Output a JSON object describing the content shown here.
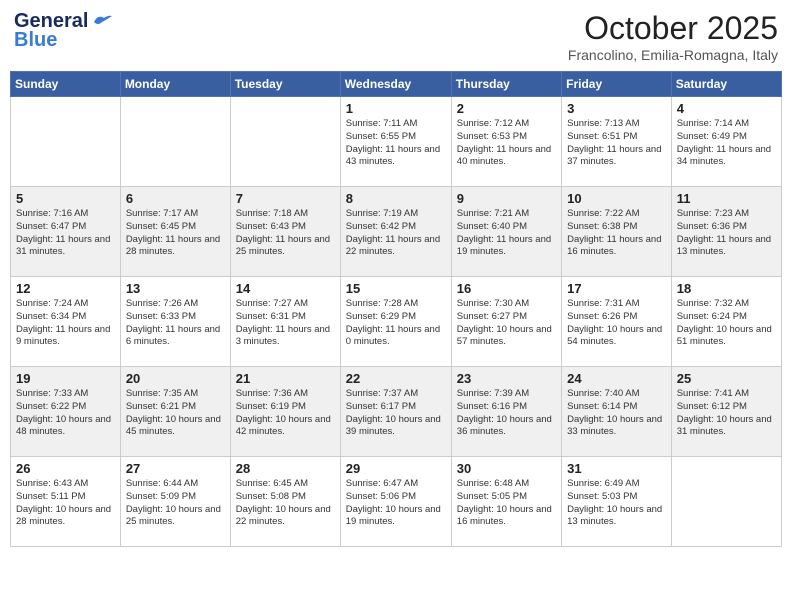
{
  "header": {
    "logo_line1": "General",
    "logo_line2": "Blue",
    "month": "October 2025",
    "location": "Francolino, Emilia-Romagna, Italy"
  },
  "days_of_week": [
    "Sunday",
    "Monday",
    "Tuesday",
    "Wednesday",
    "Thursday",
    "Friday",
    "Saturday"
  ],
  "weeks": [
    [
      {
        "day": "",
        "content": ""
      },
      {
        "day": "",
        "content": ""
      },
      {
        "day": "",
        "content": ""
      },
      {
        "day": "1",
        "content": "Sunrise: 7:11 AM\nSunset: 6:55 PM\nDaylight: 11 hours and 43 minutes."
      },
      {
        "day": "2",
        "content": "Sunrise: 7:12 AM\nSunset: 6:53 PM\nDaylight: 11 hours and 40 minutes."
      },
      {
        "day": "3",
        "content": "Sunrise: 7:13 AM\nSunset: 6:51 PM\nDaylight: 11 hours and 37 minutes."
      },
      {
        "day": "4",
        "content": "Sunrise: 7:14 AM\nSunset: 6:49 PM\nDaylight: 11 hours and 34 minutes."
      }
    ],
    [
      {
        "day": "5",
        "content": "Sunrise: 7:16 AM\nSunset: 6:47 PM\nDaylight: 11 hours and 31 minutes."
      },
      {
        "day": "6",
        "content": "Sunrise: 7:17 AM\nSunset: 6:45 PM\nDaylight: 11 hours and 28 minutes."
      },
      {
        "day": "7",
        "content": "Sunrise: 7:18 AM\nSunset: 6:43 PM\nDaylight: 11 hours and 25 minutes."
      },
      {
        "day": "8",
        "content": "Sunrise: 7:19 AM\nSunset: 6:42 PM\nDaylight: 11 hours and 22 minutes."
      },
      {
        "day": "9",
        "content": "Sunrise: 7:21 AM\nSunset: 6:40 PM\nDaylight: 11 hours and 19 minutes."
      },
      {
        "day": "10",
        "content": "Sunrise: 7:22 AM\nSunset: 6:38 PM\nDaylight: 11 hours and 16 minutes."
      },
      {
        "day": "11",
        "content": "Sunrise: 7:23 AM\nSunset: 6:36 PM\nDaylight: 11 hours and 13 minutes."
      }
    ],
    [
      {
        "day": "12",
        "content": "Sunrise: 7:24 AM\nSunset: 6:34 PM\nDaylight: 11 hours and 9 minutes."
      },
      {
        "day": "13",
        "content": "Sunrise: 7:26 AM\nSunset: 6:33 PM\nDaylight: 11 hours and 6 minutes."
      },
      {
        "day": "14",
        "content": "Sunrise: 7:27 AM\nSunset: 6:31 PM\nDaylight: 11 hours and 3 minutes."
      },
      {
        "day": "15",
        "content": "Sunrise: 7:28 AM\nSunset: 6:29 PM\nDaylight: 11 hours and 0 minutes."
      },
      {
        "day": "16",
        "content": "Sunrise: 7:30 AM\nSunset: 6:27 PM\nDaylight: 10 hours and 57 minutes."
      },
      {
        "day": "17",
        "content": "Sunrise: 7:31 AM\nSunset: 6:26 PM\nDaylight: 10 hours and 54 minutes."
      },
      {
        "day": "18",
        "content": "Sunrise: 7:32 AM\nSunset: 6:24 PM\nDaylight: 10 hours and 51 minutes."
      }
    ],
    [
      {
        "day": "19",
        "content": "Sunrise: 7:33 AM\nSunset: 6:22 PM\nDaylight: 10 hours and 48 minutes."
      },
      {
        "day": "20",
        "content": "Sunrise: 7:35 AM\nSunset: 6:21 PM\nDaylight: 10 hours and 45 minutes."
      },
      {
        "day": "21",
        "content": "Sunrise: 7:36 AM\nSunset: 6:19 PM\nDaylight: 10 hours and 42 minutes."
      },
      {
        "day": "22",
        "content": "Sunrise: 7:37 AM\nSunset: 6:17 PM\nDaylight: 10 hours and 39 minutes."
      },
      {
        "day": "23",
        "content": "Sunrise: 7:39 AM\nSunset: 6:16 PM\nDaylight: 10 hours and 36 minutes."
      },
      {
        "day": "24",
        "content": "Sunrise: 7:40 AM\nSunset: 6:14 PM\nDaylight: 10 hours and 33 minutes."
      },
      {
        "day": "25",
        "content": "Sunrise: 7:41 AM\nSunset: 6:12 PM\nDaylight: 10 hours and 31 minutes."
      }
    ],
    [
      {
        "day": "26",
        "content": "Sunrise: 6:43 AM\nSunset: 5:11 PM\nDaylight: 10 hours and 28 minutes."
      },
      {
        "day": "27",
        "content": "Sunrise: 6:44 AM\nSunset: 5:09 PM\nDaylight: 10 hours and 25 minutes."
      },
      {
        "day": "28",
        "content": "Sunrise: 6:45 AM\nSunset: 5:08 PM\nDaylight: 10 hours and 22 minutes."
      },
      {
        "day": "29",
        "content": "Sunrise: 6:47 AM\nSunset: 5:06 PM\nDaylight: 10 hours and 19 minutes."
      },
      {
        "day": "30",
        "content": "Sunrise: 6:48 AM\nSunset: 5:05 PM\nDaylight: 10 hours and 16 minutes."
      },
      {
        "day": "31",
        "content": "Sunrise: 6:49 AM\nSunset: 5:03 PM\nDaylight: 10 hours and 13 minutes."
      },
      {
        "day": "",
        "content": ""
      }
    ]
  ]
}
